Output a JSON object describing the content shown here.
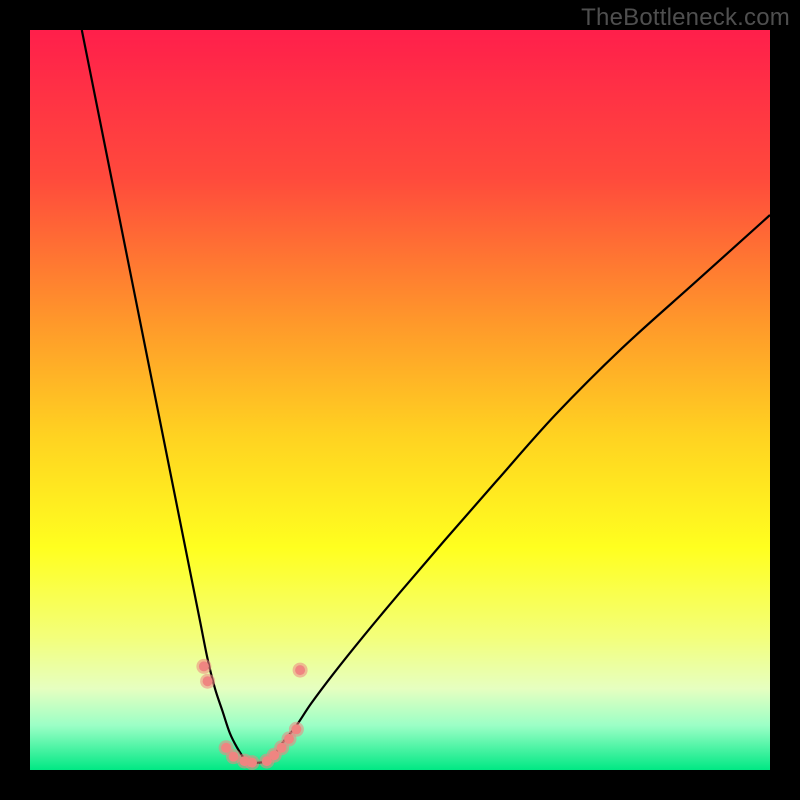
{
  "watermark": "TheBottleneck.com",
  "chart_data": {
    "type": "line",
    "title": "",
    "xlabel": "",
    "ylabel": "",
    "xlim": [
      0,
      100
    ],
    "ylim": [
      0,
      100
    ],
    "background_gradient": {
      "stops": [
        {
          "offset": 0.0,
          "color": "#ff1f4b"
        },
        {
          "offset": 0.2,
          "color": "#ff4a3c"
        },
        {
          "offset": 0.4,
          "color": "#ff9a2a"
        },
        {
          "offset": 0.55,
          "color": "#ffd321"
        },
        {
          "offset": 0.7,
          "color": "#ffff1f"
        },
        {
          "offset": 0.82,
          "color": "#f3ff7a"
        },
        {
          "offset": 0.89,
          "color": "#e6ffc0"
        },
        {
          "offset": 0.94,
          "color": "#9bffc6"
        },
        {
          "offset": 1.0,
          "color": "#00e884"
        }
      ]
    },
    "series": [
      {
        "name": "bottleneck-curve",
        "color": "#000000",
        "stroke_width": 2.2,
        "x": [
          7,
          9,
          11,
          13,
          15,
          17,
          19,
          21,
          22,
          23,
          24,
          25,
          26,
          27,
          28,
          29,
          30,
          31,
          32,
          33,
          34,
          36,
          38,
          41,
          45,
          50,
          56,
          63,
          71,
          80,
          90,
          100
        ],
        "y": [
          100,
          90,
          80,
          70,
          60,
          50,
          40,
          30,
          25,
          20,
          15,
          11,
          8,
          5,
          3,
          1.5,
          1,
          1,
          1.2,
          2,
          3.5,
          6,
          9,
          13,
          18,
          24,
          31,
          39,
          48,
          57,
          66,
          75
        ]
      }
    ],
    "markers": {
      "name": "highlighted-points",
      "color": "#ef8581",
      "radius_outer": 7.5,
      "radius_inner": 5.0,
      "points": [
        {
          "x": 23.5,
          "y": 14
        },
        {
          "x": 24.0,
          "y": 12
        },
        {
          "x": 26.5,
          "y": 3.0
        },
        {
          "x": 27.5,
          "y": 1.8
        },
        {
          "x": 29.0,
          "y": 1.2
        },
        {
          "x": 30.0,
          "y": 1.0
        },
        {
          "x": 32.0,
          "y": 1.2
        },
        {
          "x": 33.0,
          "y": 2.0
        },
        {
          "x": 34.0,
          "y": 3.0
        },
        {
          "x": 35.0,
          "y": 4.2
        },
        {
          "x": 36.0,
          "y": 5.5
        },
        {
          "x": 36.5,
          "y": 13.5
        }
      ]
    }
  }
}
